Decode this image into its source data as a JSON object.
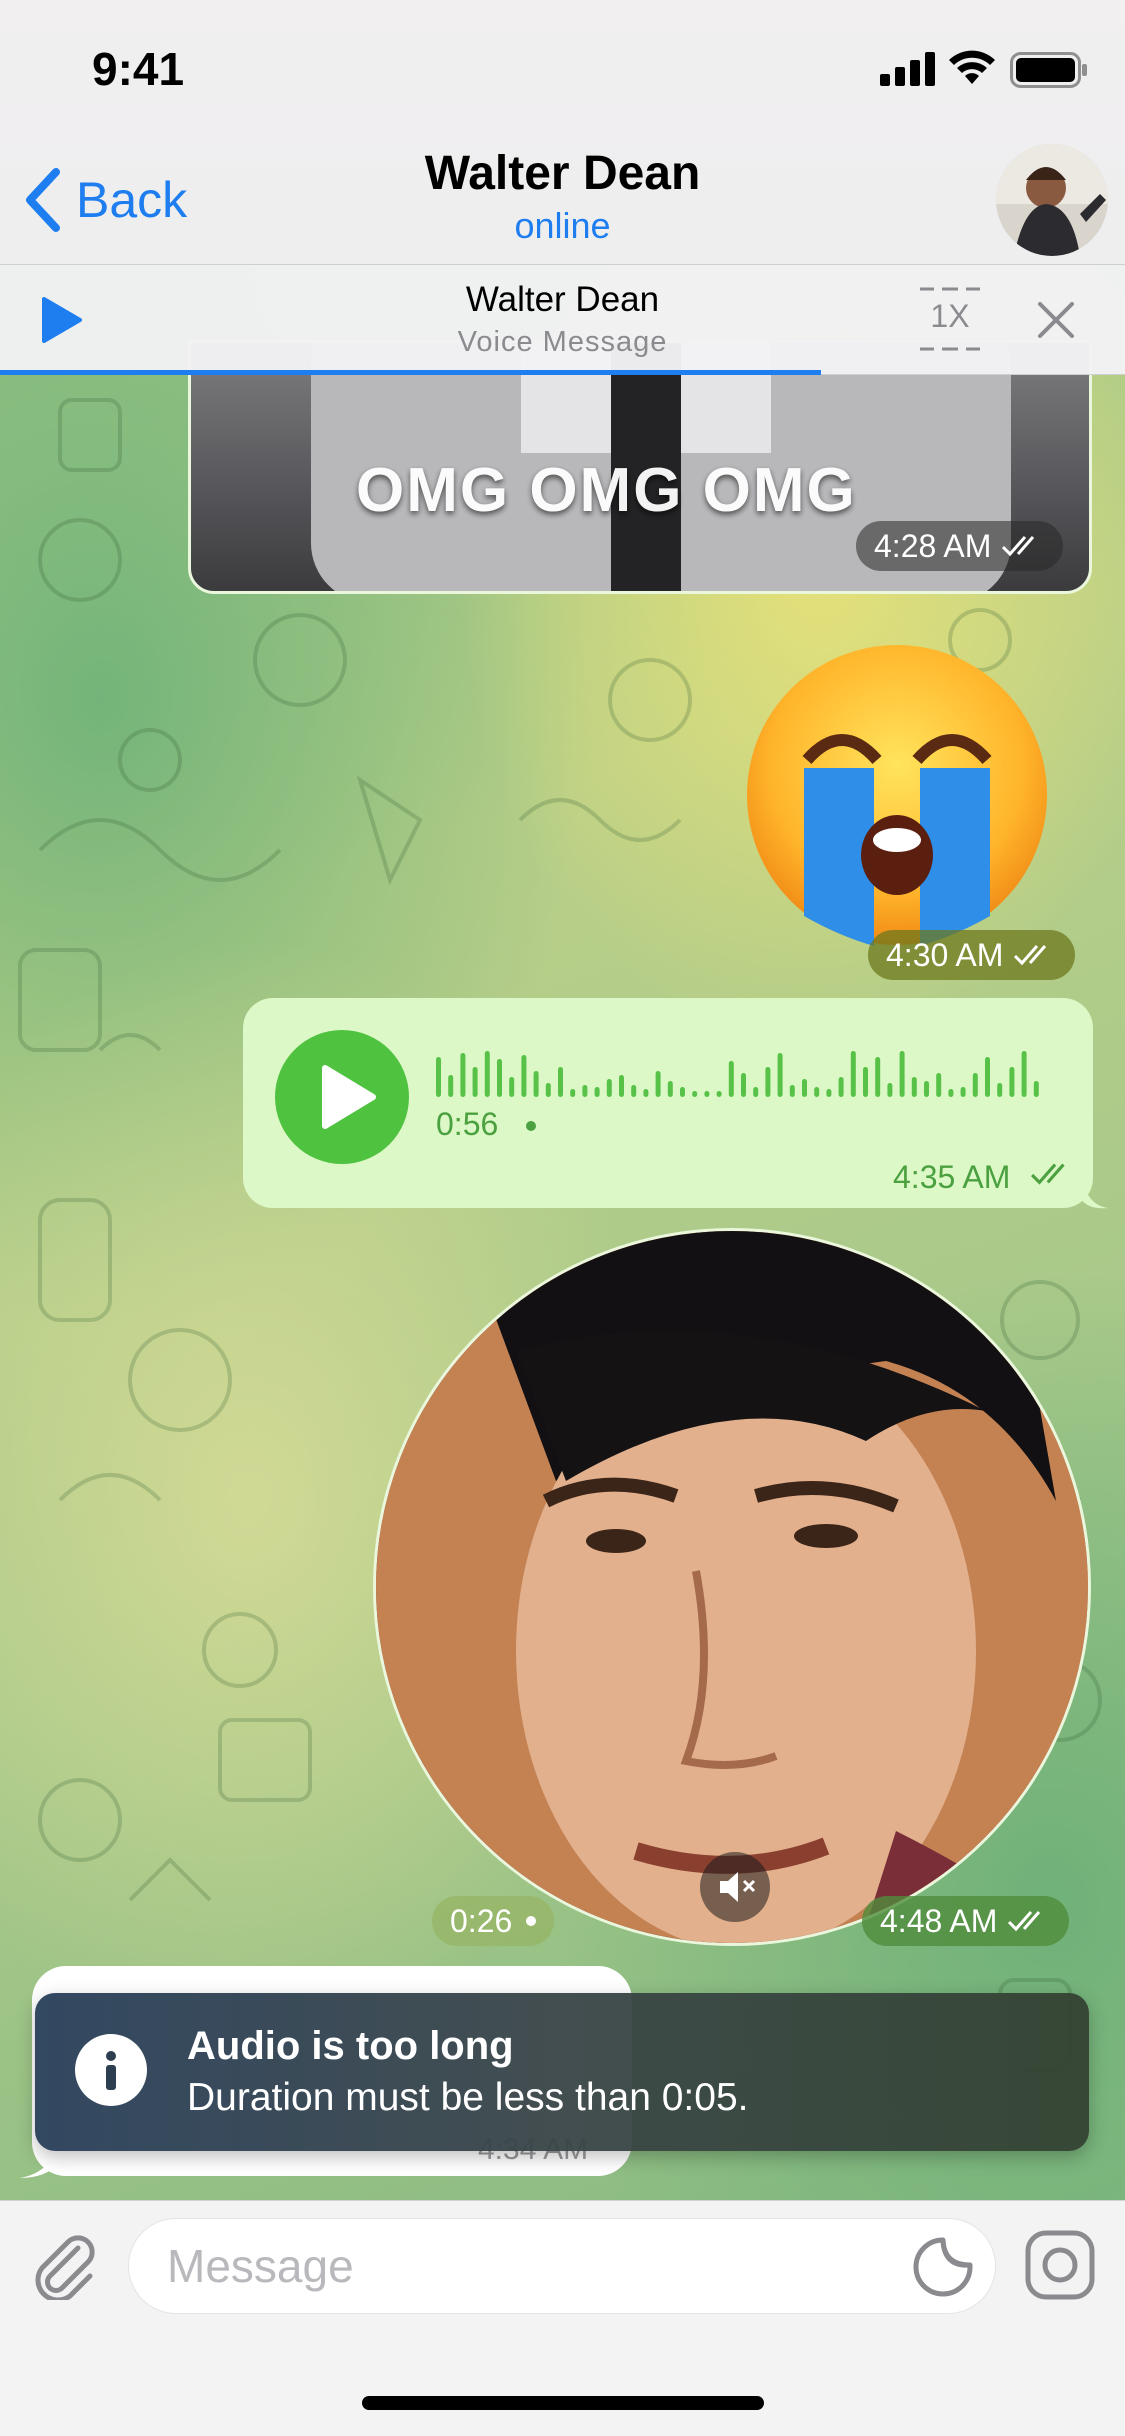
{
  "status_bar": {
    "time": "9:41"
  },
  "header": {
    "back_label": "Back",
    "title": "Walter Dean",
    "status": "online"
  },
  "player": {
    "title": "Walter Dean",
    "subtitle": "Voice Message",
    "speed": "1X",
    "progress_percent": 73
  },
  "messages": {
    "gif": {
      "caption": "OMG OMG OMG",
      "time": "4:28 AM"
    },
    "emoji": {
      "time": "4:30 AM"
    },
    "voice": {
      "duration": "0:56",
      "time": "4:35 AM"
    },
    "video": {
      "duration": "0:26",
      "time": "4:48 AM"
    },
    "incoming": {
      "time": "4:34 AM"
    }
  },
  "toast": {
    "title": "Audio is too long",
    "message": "Duration must be less than 0:05."
  },
  "input": {
    "placeholder": "Message"
  },
  "colors": {
    "accent": "#1e7ef0",
    "outgoing_bubble": "#dcf8c7",
    "voice_green": "#4fc23f"
  }
}
